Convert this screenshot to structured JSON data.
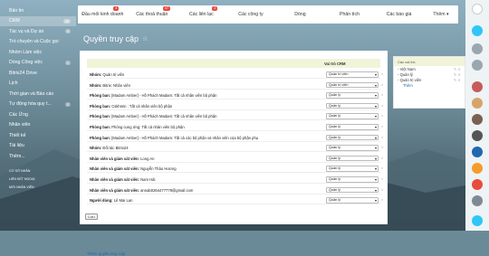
{
  "sidebar": {
    "items": [
      {
        "label": "Bản tin",
        "badge": "",
        "active": false
      },
      {
        "label": "CRM",
        "badge": "29",
        "active": true
      },
      {
        "label": "Tác vụ và Dự án",
        "badge": "9",
        "active": false
      },
      {
        "label": "Trò chuyện và Cuộc gọi",
        "badge": "",
        "active": false
      },
      {
        "label": "Nhóm Làm việc",
        "badge": "",
        "active": false
      },
      {
        "label": "Dòng Công việc",
        "badge": "1",
        "active": false
      },
      {
        "label": "Bitrix24 Drive",
        "badge": "",
        "active": false
      },
      {
        "label": "Lịch",
        "badge": "",
        "active": false
      },
      {
        "label": "Thời gian và Báo cáo",
        "badge": "",
        "active": false
      },
      {
        "label": "Tự động hóa quy t...",
        "badge": "2",
        "active": false
      },
      {
        "label": "Các Ứng",
        "badge": "",
        "active": false
      },
      {
        "label": "Nhân viên",
        "badge": "",
        "active": false
      },
      {
        "label": "Thiết kế",
        "badge": "",
        "active": false
      },
      {
        "label": "Tài liệu",
        "badge": "",
        "active": false
      },
      {
        "label": "Thêm...",
        "badge": "",
        "active": false
      }
    ],
    "footer": [
      "CƠ SỞ NHÂN",
      "LIÊN KẾT NGOẠI",
      "MỜI NHÂN VIÊN"
    ]
  },
  "topbar": {
    "tabs": [
      {
        "label": "Đầu mối kinh doanh",
        "badge": "4"
      },
      {
        "label": "Các thoả thuận",
        "badge": "47"
      },
      {
        "label": "Các liên lạc",
        "badge": "2"
      },
      {
        "label": "Các công ty",
        "badge": ""
      },
      {
        "label": "Dòng",
        "badge": ""
      },
      {
        "label": "Phân tích",
        "badge": ""
      },
      {
        "label": "Các báo giá",
        "badge": ""
      },
      {
        "label": "Thêm",
        "badge": ""
      }
    ]
  },
  "page": {
    "title": "Quyền truy cập"
  },
  "table": {
    "header": "Vai trò CRM",
    "rows": [
      {
        "prefix": "Nhóm:",
        "text": " Quản trị viên",
        "role": "Quản trị viên"
      },
      {
        "prefix": "Nhóm:",
        "text": " Bitrix: Nhân viên",
        "role": "Quản trị viên"
      },
      {
        "prefix": "Phòng ban:",
        "text": " [Madam Amber] - Hồ Phách Madam: Tất cả nhân viên bộ phận",
        "role": "Quản lý"
      },
      {
        "prefix": "Phòng ban:",
        "text": " Cskhmin : Tất cả nhân viên bộ phận",
        "role": "Quản lý"
      },
      {
        "prefix": "Phòng ban:",
        "text": " [Madam Amber] - Hồ Phách Madam: Tất cả nhân viên bộ phận",
        "role": "Quản lý"
      },
      {
        "prefix": "Phòng ban:",
        "text": " Phòng cung ứng: Tất cả nhân viên bộ phận",
        "role": "Quản lý"
      },
      {
        "prefix": "Phòng ban:",
        "text": " [Madam Amber] - Hồ Phách Madam: Tất cả các bộ phận và nhân viên của bộ phận phụ",
        "role": "Quản lý"
      },
      {
        "prefix": "Nhóm:",
        "text": " Đối tác Bitrix24",
        "role": "Quản lý"
      },
      {
        "prefix": "Nhân viên và giám sát viên:",
        "text": " Long An",
        "role": "Quản lý"
      },
      {
        "prefix": "Nhân viên và giám sát viên:",
        "text": " Nguyễn Thảo Hương",
        "role": "Quản lý"
      },
      {
        "prefix": "Nhân viên và giám sát viên:",
        "text": " Nam Hải",
        "role": "Quản lý"
      },
      {
        "prefix": "Nhân viên và giám sát viên:",
        "text": " annab0264477779@gmail.com",
        "role": "Quản lý"
      },
      {
        "prefix": "Người dùng:",
        "text": " Lê Mai Lan",
        "role": "Quản lý"
      }
    ],
    "add_link": "Thêm quyền truy cập",
    "save_label": "Lưu"
  },
  "roles": {
    "header": "Các vai trò:",
    "items": [
      "Việt Nam",
      "Quản lý",
      "Quản trị viên"
    ],
    "add_label": "Thêm"
  },
  "colors": {
    "accent": "#2067b0",
    "badge": "#e84c3d",
    "table_header": "#f1f4d8"
  }
}
